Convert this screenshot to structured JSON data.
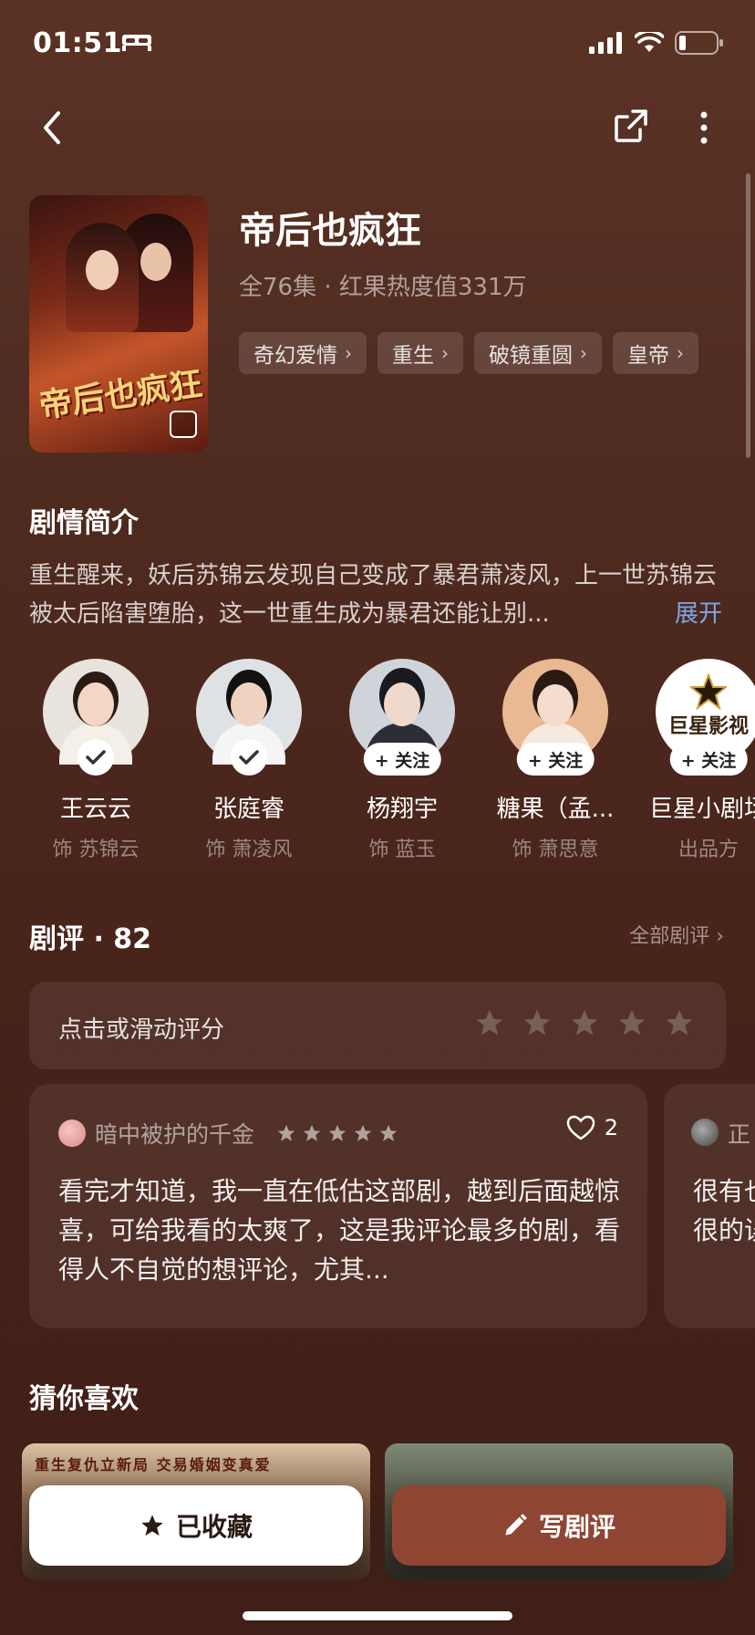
{
  "status_bar": {
    "time": "01:51"
  },
  "show": {
    "title": "帝后也疯狂",
    "meta": "全76集 · 红果热度值331万",
    "poster_art_text": "帝后也疯狂",
    "tags": [
      "奇幻爱情",
      "重生",
      "破镜重圆",
      "皇帝"
    ]
  },
  "synopsis": {
    "title": "剧情简介",
    "text": "重生醒来，妖后苏锦云发现自己变成了暴君萧凌风，上一世苏锦云被太后陷害堕胎，这一世重生成为暴君还能让别...",
    "expand_label": "展开"
  },
  "cast": [
    {
      "name": "王云云",
      "role": "饰 苏锦云",
      "followed": true,
      "follow_label": ""
    },
    {
      "name": "张庭睿",
      "role": "饰 萧凌风",
      "followed": true,
      "follow_label": ""
    },
    {
      "name": "杨翔宇",
      "role": "饰 蓝玉",
      "followed": false,
      "follow_label": "+ 关注"
    },
    {
      "name": "糖果（孟...",
      "role": "饰 萧思意",
      "followed": false,
      "follow_label": "+ 关注"
    },
    {
      "name": "巨星小剧场",
      "role": "出品方",
      "followed": false,
      "follow_label": "+ 关注",
      "logo_text": "巨星影视"
    }
  ],
  "reviews": {
    "title": "剧评 · 82",
    "all_label": "全部剧评 ›",
    "rate_prompt": "点击或滑动评分",
    "items": [
      {
        "user": "暗中被护的千金",
        "stars": 5,
        "likes": "2",
        "text": "看完才知道，我一直在低估这部剧，越到后面越惊喜，可给我看的太爽了，这是我评论最多的剧，看得人不自觉的想评论，尤其..."
      },
      {
        "user": "正",
        "text": "很有也很的误"
      }
    ]
  },
  "recommend": {
    "title": "猜你喜欢",
    "items": [
      {
        "banner": "重生复仇立新局 交易婚姻变真爱"
      },
      {
        "banner": ""
      }
    ]
  },
  "actions": {
    "collect_label": "已收藏",
    "write_label": "写剧评"
  },
  "colors": {
    "accent_button": "#8e4632",
    "link": "#7ea7e6"
  }
}
